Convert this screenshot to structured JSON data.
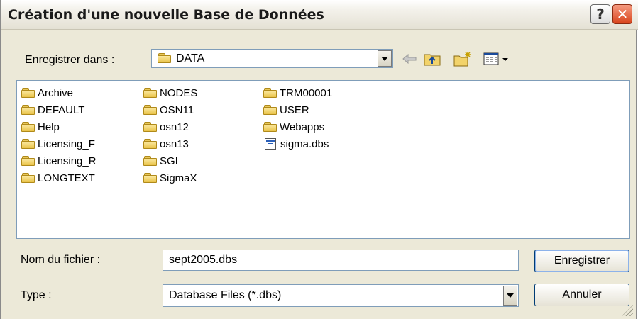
{
  "window": {
    "title": "Création d'une nouvelle Base de Données",
    "help_label": "?",
    "close_label": "✕"
  },
  "save_in": {
    "label": "Enregistrer dans :",
    "value": "DATA"
  },
  "toolbar": [
    "back-arrow-icon",
    "up-folder-icon",
    "new-folder-icon",
    "view-menu-icon"
  ],
  "files": {
    "col1": [
      "Archive",
      "DEFAULT",
      "Help",
      "Licensing_F",
      "Licensing_R",
      "LONGTEXT"
    ],
    "col2": [
      "NODES",
      "OSN11",
      "osn12",
      "osn13",
      "SGI",
      "SigmaX"
    ],
    "col3": [
      "TRM00001",
      "USER",
      "Webapps"
    ],
    "db_file": "sigma.dbs"
  },
  "filename": {
    "label": "Nom du fichier :",
    "value": "sept2005.dbs"
  },
  "filetype": {
    "label": "Type :",
    "value": "Database Files (*.dbs)"
  },
  "buttons": {
    "save": "Enregistrer",
    "cancel": "Annuler"
  },
  "colors": {
    "accent": "#003c74",
    "folder": "#e9c34a",
    "close": "#d8441c"
  }
}
